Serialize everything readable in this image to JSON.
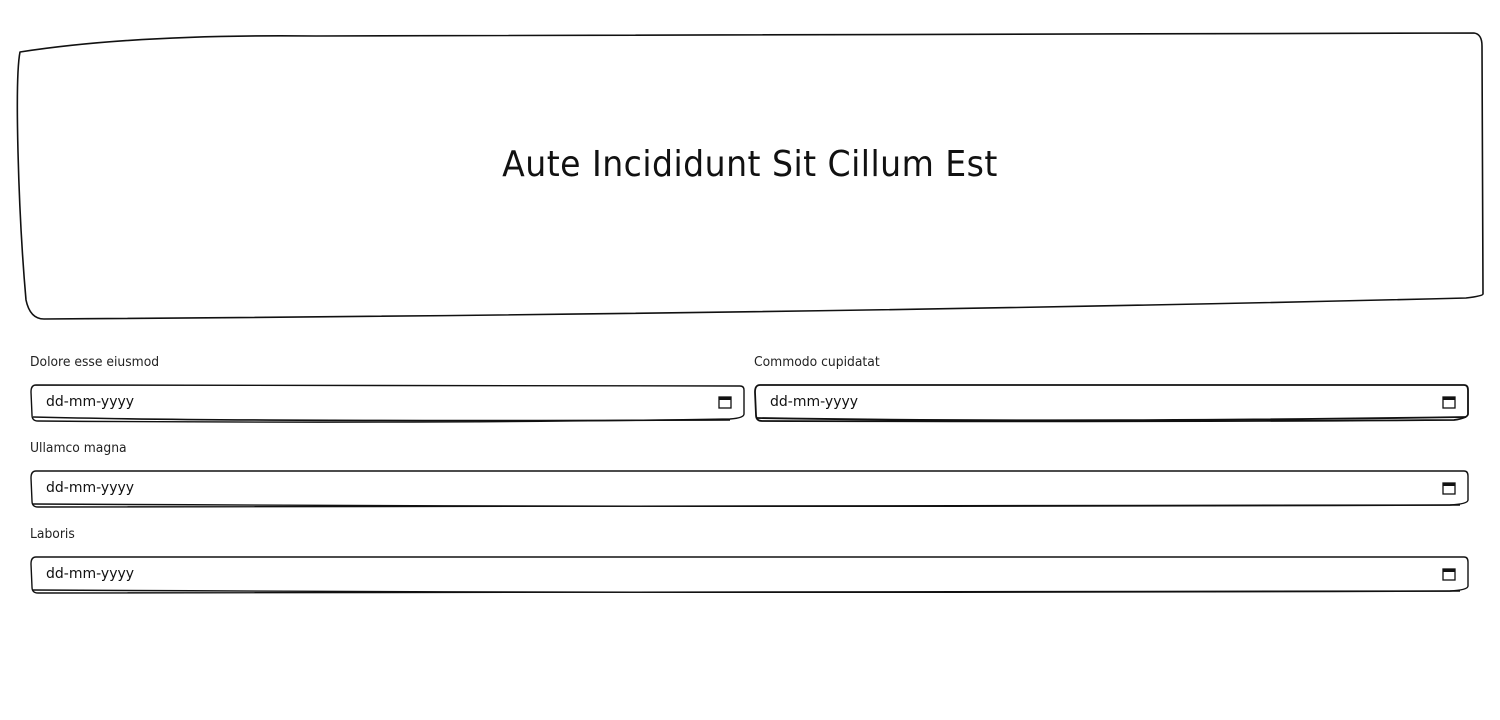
{
  "hero": {
    "title": "Aute Incididunt Sit Cillum Est"
  },
  "form": {
    "fields": [
      {
        "label": "Dolore esse eiusmod",
        "placeholder": "dd-mm-yyyy"
      },
      {
        "label": "Commodo cupidatat",
        "placeholder": "dd-mm-yyyy"
      },
      {
        "label": "Ullamco magna",
        "placeholder": "dd-mm-yyyy"
      },
      {
        "label": "Laboris",
        "placeholder": "dd-mm-yyyy"
      }
    ]
  },
  "icons": {
    "calendar": "calendar-icon"
  },
  "colors": {
    "stroke": "#111111",
    "background": "#ffffff"
  }
}
